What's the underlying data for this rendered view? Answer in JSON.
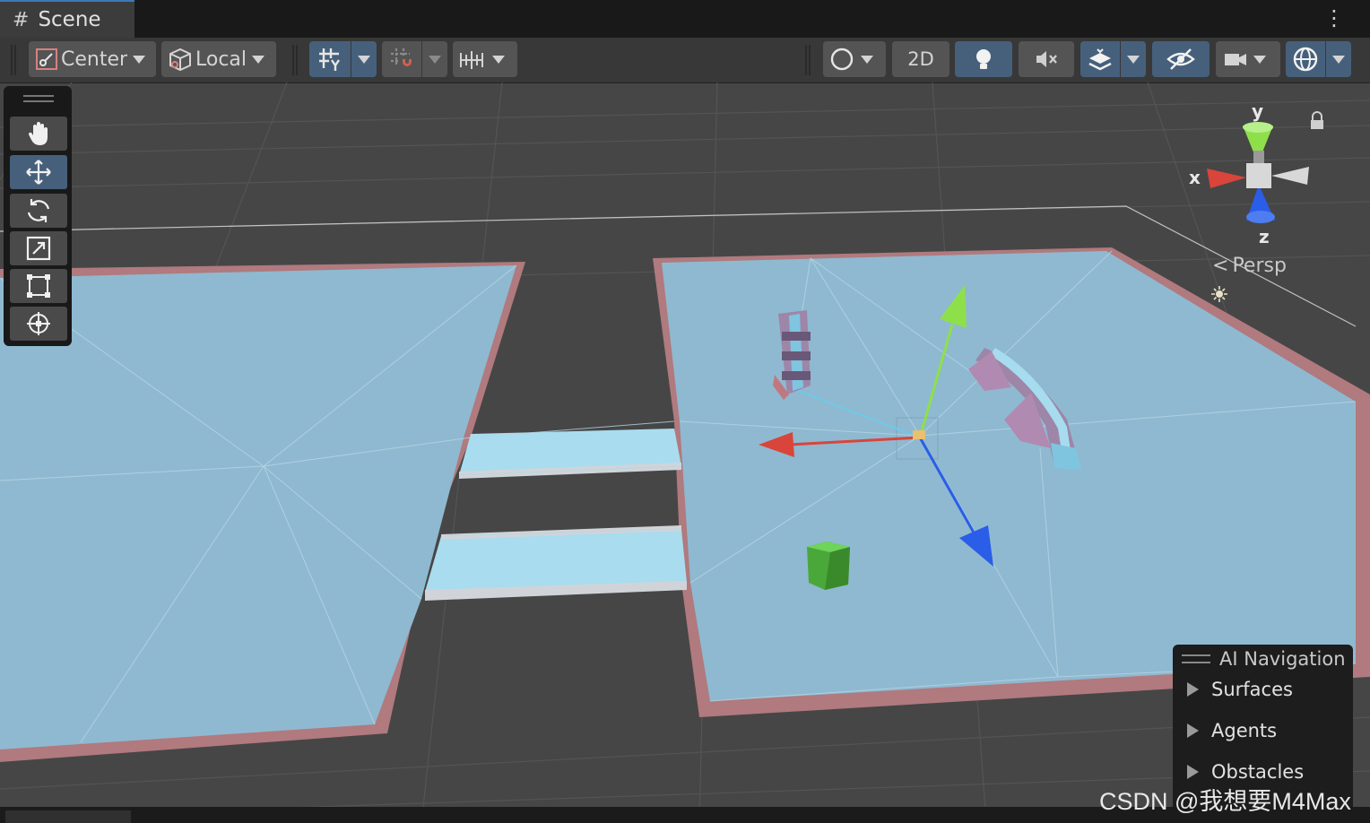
{
  "tab": {
    "title": "Scene",
    "icon": "#",
    "menu_glyph": "⋮"
  },
  "toolbar": {
    "pivot_label": "Center",
    "handle_label": "Local",
    "mode_2d_label": "2D"
  },
  "gizmo": {
    "y_label": "y",
    "x_label": "x",
    "z_label": "z",
    "projection_label": "Persp"
  },
  "overlay": {
    "title": "AI Navigation",
    "items": [
      {
        "label": "Surfaces"
      },
      {
        "label": "Agents"
      },
      {
        "label": "Obstacles"
      }
    ]
  },
  "watermark": "CSDN @我想要M4Max",
  "colors": {
    "navmesh": "#8fb9d0",
    "ledge": "#b07a7e",
    "grid_bg": "#464646",
    "axis_x": "#d9453a",
    "axis_y": "#8ee04a",
    "axis_z": "#2a5de8",
    "selection": "#46607c"
  }
}
